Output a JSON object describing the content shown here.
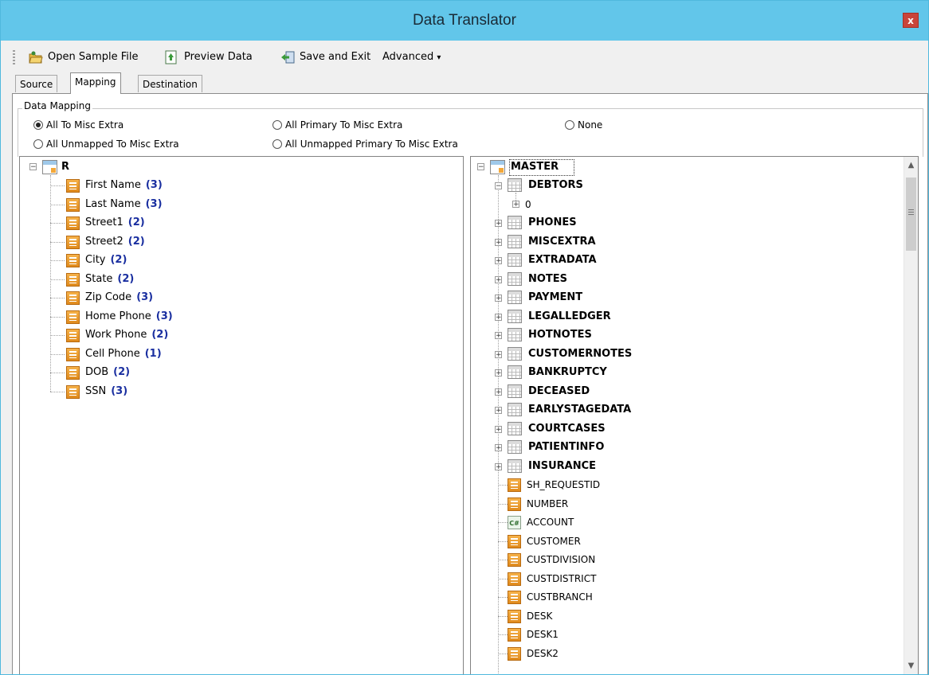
{
  "window": {
    "title": "Data Translator",
    "close_label": "x"
  },
  "toolbar": {
    "open_sample": "Open Sample File",
    "preview": "Preview Data",
    "save_exit": "Save and Exit",
    "advanced": "Advanced",
    "advanced_arrow": "▾"
  },
  "tabs": [
    "Source",
    "Mapping",
    "Destination"
  ],
  "active_tab": "Mapping",
  "mapping": {
    "group_label": "Data Mapping",
    "options": [
      {
        "label": "All To Misc Extra",
        "selected": true
      },
      {
        "label": "All Primary To Misc Extra",
        "selected": false
      },
      {
        "label": "None",
        "selected": false
      },
      {
        "label": "All Unmapped To Misc Extra",
        "selected": false
      },
      {
        "label": "All Unmapped Primary To Misc Extra",
        "selected": false
      }
    ]
  },
  "source_tree": {
    "root": "R",
    "root_expander": "−",
    "fields": [
      {
        "label": "First Name",
        "count": "(3)"
      },
      {
        "label": "Last Name",
        "count": "(3)"
      },
      {
        "label": "Street1",
        "count": "(2)"
      },
      {
        "label": "Street2",
        "count": "(2)"
      },
      {
        "label": "City",
        "count": "(2)"
      },
      {
        "label": "State",
        "count": "(2)"
      },
      {
        "label": "Zip Code",
        "count": "(3)"
      },
      {
        "label": "Home Phone",
        "count": "(3)"
      },
      {
        "label": "Work Phone",
        "count": "(2)"
      },
      {
        "label": "Cell Phone",
        "count": "(1)"
      },
      {
        "label": "DOB",
        "count": "(2)"
      },
      {
        "label": "SSN",
        "count": "(3)"
      }
    ]
  },
  "dest_tree": {
    "root": "MASTER",
    "expanded_table": "DEBTORS",
    "debtors_child": "0",
    "expand_minus": "−",
    "expand_plus": "+",
    "key_icon_text": "C#",
    "tables": [
      "PHONES",
      "MISCEXTRA",
      "EXTRADATA",
      "NOTES",
      "PAYMENT",
      "LEGALLEDGER",
      "HOTNOTES",
      "CUSTOMERNOTES",
      "BANKRUPTCY",
      "DECEASED",
      "EARLYSTAGEDATA",
      "COURTCASES",
      "PATIENTINFO",
      "INSURANCE"
    ],
    "fields": [
      {
        "label": "SH_REQUESTID",
        "icon": "field-icon"
      },
      {
        "label": "NUMBER",
        "icon": "field-icon"
      },
      {
        "label": "ACCOUNT",
        "icon": "key-field-icon"
      },
      {
        "label": "CUSTOMER",
        "icon": "field-icon"
      },
      {
        "label": "CUSTDIVISION",
        "icon": "field-icon"
      },
      {
        "label": "CUSTDISTRICT",
        "icon": "field-icon"
      },
      {
        "label": "CUSTBRANCH",
        "icon": "field-icon"
      },
      {
        "label": "DESK",
        "icon": "field-icon"
      },
      {
        "label": "DESK1",
        "icon": "field-icon"
      },
      {
        "label": "DESK2",
        "icon": "field-icon"
      }
    ]
  },
  "scrollbar": {
    "up": "▲",
    "down": "▼",
    "grip": "≡"
  },
  "colors": {
    "titlebar": "#62c6ea",
    "count": "#1a2fa0",
    "close": "#c9443a"
  }
}
